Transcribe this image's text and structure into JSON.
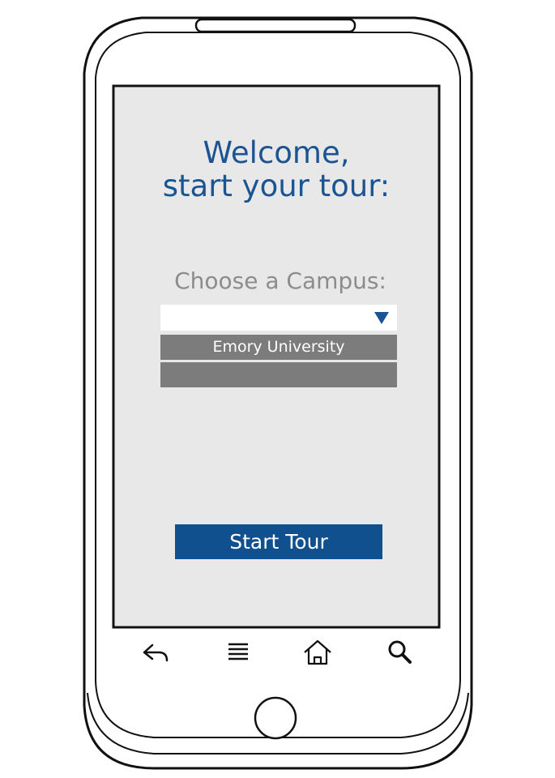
{
  "screen": {
    "welcome_line1": "Welcome,",
    "welcome_line2": "start your tour:",
    "campus_label": "Choose a Campus:",
    "dropdown": {
      "selected_value": "",
      "arrow_icon": "triangle-down-icon",
      "options": [
        "Emory University",
        ""
      ]
    },
    "start_button_label": "Start Tour"
  },
  "device": {
    "softkeys": [
      "back-icon",
      "menu-icon",
      "home-icon",
      "search-icon"
    ],
    "hardware_button": "home-hardware-button"
  },
  "colors": {
    "accent_blue": "#1a5493",
    "button_blue": "#11508f",
    "label_gray": "#8c8c8c",
    "option_gray": "#7c7c7c",
    "screen_bg": "#e8e8e8"
  }
}
